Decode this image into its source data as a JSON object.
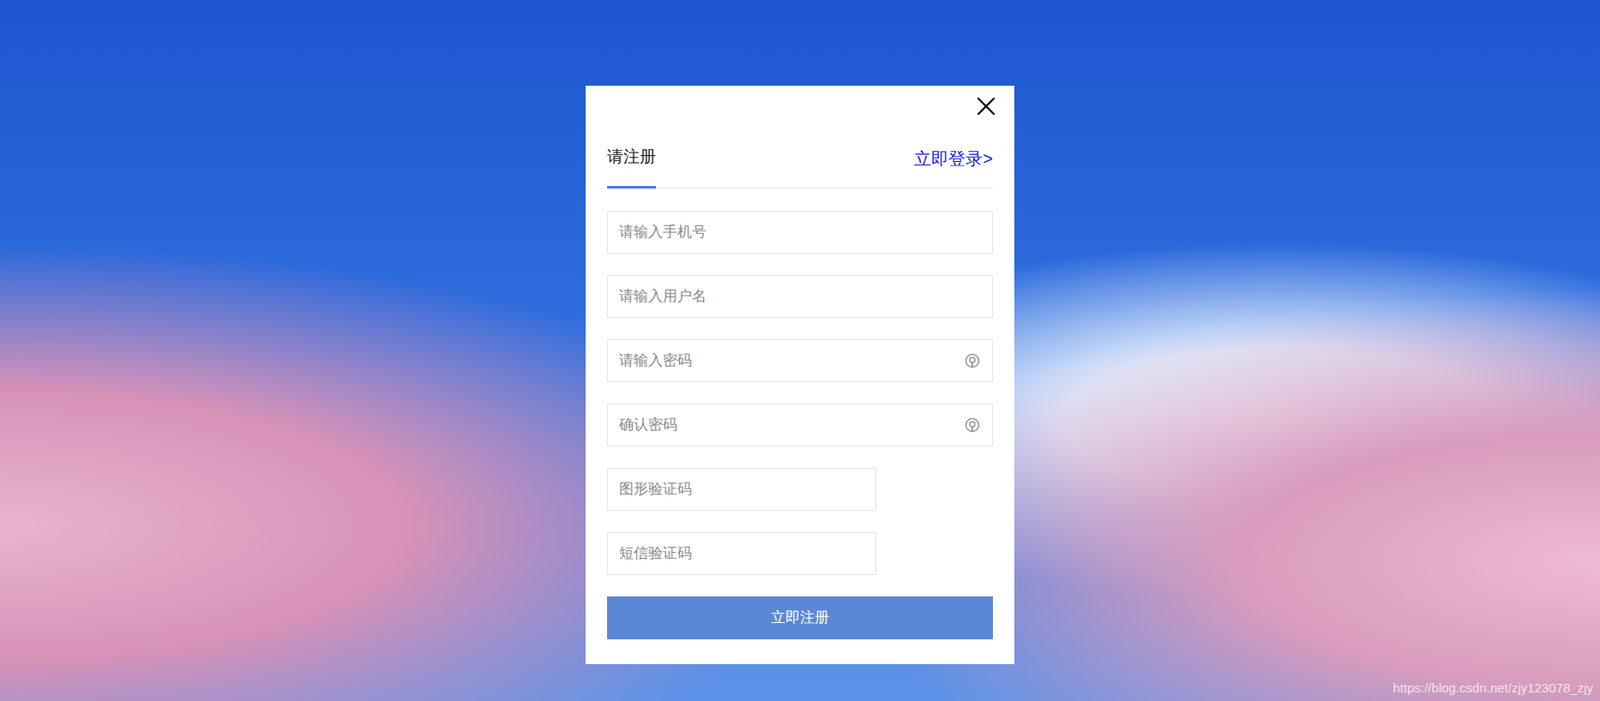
{
  "dialog": {
    "tabs": [
      {
        "label": "请注册",
        "selected": true
      }
    ],
    "link": "立即登录>",
    "fields": [
      {
        "placeholder": "请输入手机号",
        "kind": "text"
      },
      {
        "placeholder": "请输入用户名",
        "kind": "text"
      },
      {
        "placeholder": "请输入密码",
        "kind": "password"
      },
      {
        "placeholder": "确认密码",
        "kind": "password"
      },
      {
        "placeholder": "图形验证码",
        "kind": "short"
      },
      {
        "placeholder": "短信验证码",
        "kind": "short"
      }
    ],
    "submit": "立即注册"
  },
  "watermark": "https://blog.csdn.net/zjy123078_zjy"
}
